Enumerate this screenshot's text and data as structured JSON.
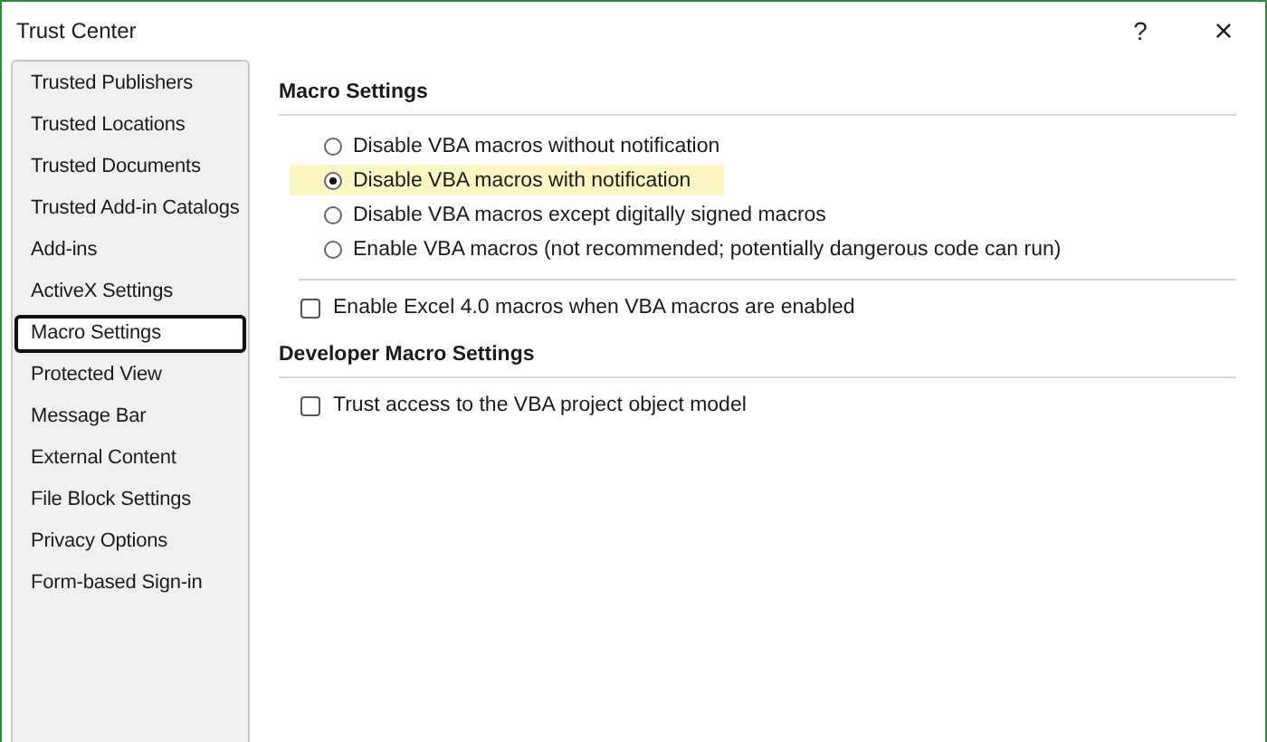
{
  "window": {
    "title": "Trust Center",
    "help": "?",
    "close": "×"
  },
  "sidebar": {
    "items": [
      {
        "label": "Trusted Publishers",
        "selected": false
      },
      {
        "label": "Trusted Locations",
        "selected": false
      },
      {
        "label": "Trusted Documents",
        "selected": false
      },
      {
        "label": "Trusted Add-in Catalogs",
        "selected": false
      },
      {
        "label": "Add-ins",
        "selected": false
      },
      {
        "label": "ActiveX Settings",
        "selected": false
      },
      {
        "label": "Macro Settings",
        "selected": true
      },
      {
        "label": "Protected View",
        "selected": false
      },
      {
        "label": "Message Bar",
        "selected": false
      },
      {
        "label": "External Content",
        "selected": false
      },
      {
        "label": "File Block Settings",
        "selected": false
      },
      {
        "label": "Privacy Options",
        "selected": false
      },
      {
        "label": "Form-based Sign-in",
        "selected": false
      }
    ]
  },
  "macro_settings": {
    "heading": "Macro Settings",
    "options": [
      {
        "label": "Disable VBA macros without notification",
        "selected": false
      },
      {
        "label": "Disable VBA macros with notification",
        "selected": true
      },
      {
        "label": "Disable VBA macros except digitally signed macros",
        "selected": false
      },
      {
        "label": "Enable VBA macros (not recommended; potentially dangerous code can run)",
        "selected": false
      }
    ],
    "excel4": {
      "label": "Enable Excel 4.0 macros when VBA macros are enabled",
      "checked": false
    }
  },
  "developer_macro_settings": {
    "heading": "Developer Macro Settings",
    "trust_vba": {
      "label": "Trust access to the VBA project object model",
      "checked": false
    }
  }
}
